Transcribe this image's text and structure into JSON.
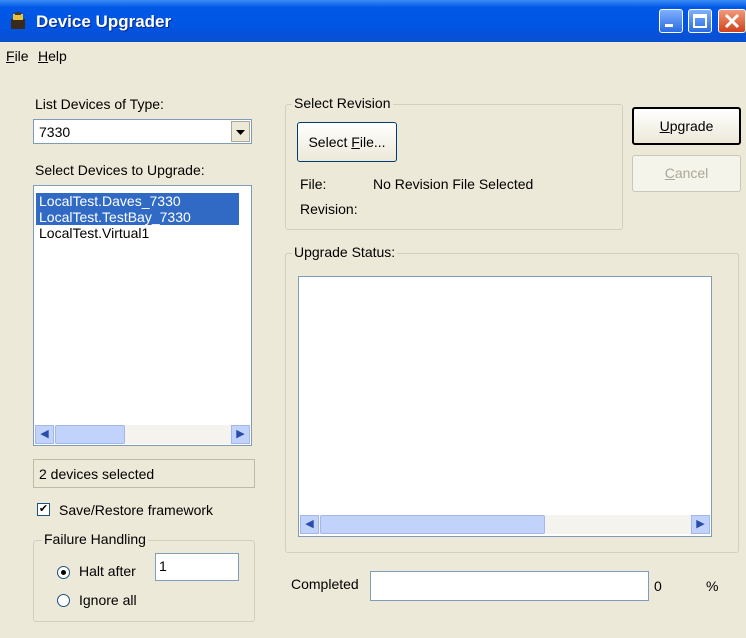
{
  "window": {
    "title": "Device Upgrader"
  },
  "menu": {
    "items": [
      {
        "label": "File",
        "accel": "F",
        "rest": "ile"
      },
      {
        "label": "Help",
        "accel": "H",
        "rest": "elp"
      }
    ]
  },
  "device_type": {
    "label": "List Devices of Type:",
    "value": "7330"
  },
  "devices": {
    "label": "Select Devices to Upgrade:",
    "items": [
      {
        "name": "LocalTest.Daves_7330",
        "selected": true
      },
      {
        "name": "LocalTest.TestBay_7330",
        "selected": true
      },
      {
        "name": "LocalTest.Virtual1",
        "selected": false
      }
    ],
    "status": "2 devices selected"
  },
  "save_restore": {
    "label": "Save/Restore framework",
    "checked": true
  },
  "failure_handling": {
    "title": "Failure Handling",
    "halt_label": "Halt after",
    "halt_value": "1",
    "ignore_label": "Ignore all",
    "selected": "halt"
  },
  "revision": {
    "title": "Select Revision",
    "select_button": {
      "label": "Select File...",
      "pre": "Select ",
      "accel": "F",
      "post": "ile..."
    },
    "file_label": "File:",
    "file_value": "No Revision File Selected",
    "revision_label": "Revision:",
    "revision_value": ""
  },
  "buttons": {
    "upgrade": {
      "label": "Upgrade",
      "accel": "U",
      "rest": "pgrade",
      "enabled": true
    },
    "cancel": {
      "label": "Cancel",
      "accel": "C",
      "rest": "ancel",
      "enabled": false
    }
  },
  "upgrade_status": {
    "title": "Upgrade Status:"
  },
  "completed": {
    "label": "Completed",
    "value": "0",
    "unit": "%",
    "progress_fraction": 0
  }
}
